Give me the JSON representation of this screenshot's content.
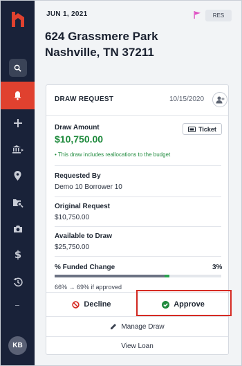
{
  "sidebar": {
    "logo_icon": "brand-logo-icon",
    "items": [
      {
        "icon": "search-icon",
        "label": "Search"
      },
      {
        "icon": "bell-icon",
        "label": "Notifications",
        "active": true
      },
      {
        "icon": "plus-icon",
        "label": "Add"
      },
      {
        "icon": "bank-transfer-icon",
        "label": "Transfers"
      },
      {
        "icon": "map-pin-icon",
        "label": "Locations"
      },
      {
        "icon": "folder-search-icon",
        "label": "Documents"
      },
      {
        "icon": "camera-icon",
        "label": "Photos"
      },
      {
        "icon": "dollar-icon",
        "label": "Finance"
      },
      {
        "icon": "history-icon",
        "label": "History"
      }
    ],
    "avatar_initials": "KB"
  },
  "header": {
    "date": "JUN 1, 2021",
    "badge": "RES",
    "address_line1": "624 Grassmere Park",
    "address_line2": "Nashville, TN 37211"
  },
  "card": {
    "title": "DRAW REQUEST",
    "date": "10/15/2020",
    "draw_amount_label": "Draw Amount",
    "draw_amount": "$10,750.00",
    "reallocation_note": "This draw includes reallocations to the budget",
    "ticket_label": "Ticket",
    "requested_by_label": "Requested By",
    "requested_by": "Demo 10 Borrower 10",
    "original_request_label": "Original Request",
    "original_request": "$10,750.00",
    "available_label": "Available to Draw",
    "available": "$25,750.00",
    "funded_label": "% Funded Change",
    "funded_pct": "3%",
    "funded_from": 0.66,
    "funded_to": 0.69,
    "funded_note": "66% → 69% if approved",
    "decline_label": "Decline",
    "approve_label": "Approve",
    "manage_label": "Manage Draw",
    "view_loan_label": "View Loan"
  },
  "colors": {
    "sidebar_bg": "#192239",
    "accent_red": "#e0412f",
    "success_green": "#1e8a3c",
    "highlight_red": "#d62b23",
    "flag_pink": "#e052c4"
  }
}
